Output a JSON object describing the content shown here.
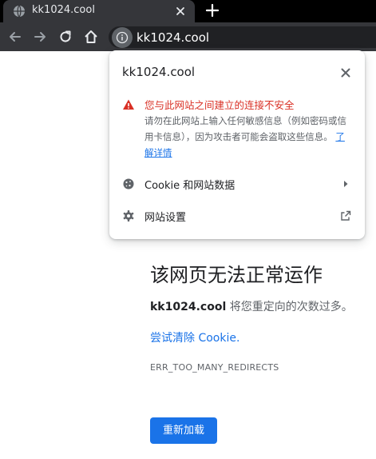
{
  "tab": {
    "title": "kk1024.cool"
  },
  "omnibox": {
    "url": "kk1024.cool"
  },
  "popup": {
    "host": "kk1024.cool",
    "warning_title": "您与此网站之间建立的连接不安全",
    "warning_body": "请勿在此网站上输入任何敏感信息（例如密码或信用卡信息），因为攻击者可能会盗取这些信息。",
    "learn_more": "了解详情",
    "rows": [
      {
        "label": "Cookie 和网站数据",
        "icon": "cookie-icon",
        "trail": "chevron-right-icon"
      },
      {
        "label": "网站设置",
        "icon": "gear-icon",
        "trail": "external-link-icon"
      }
    ]
  },
  "error": {
    "title": "该网页无法正常运作",
    "host": "kk1024.cool",
    "desc_suffix": " 将您重定向的次数过多。",
    "link": "尝试清除 Cookie.",
    "code": "ERR_TOO_MANY_REDIRECTS",
    "reload": "重新加载"
  },
  "colors": {
    "accent": "#1a73e8",
    "warning": "#d93025",
    "toolbar": "#35363a",
    "tabstrip": "#000000"
  }
}
